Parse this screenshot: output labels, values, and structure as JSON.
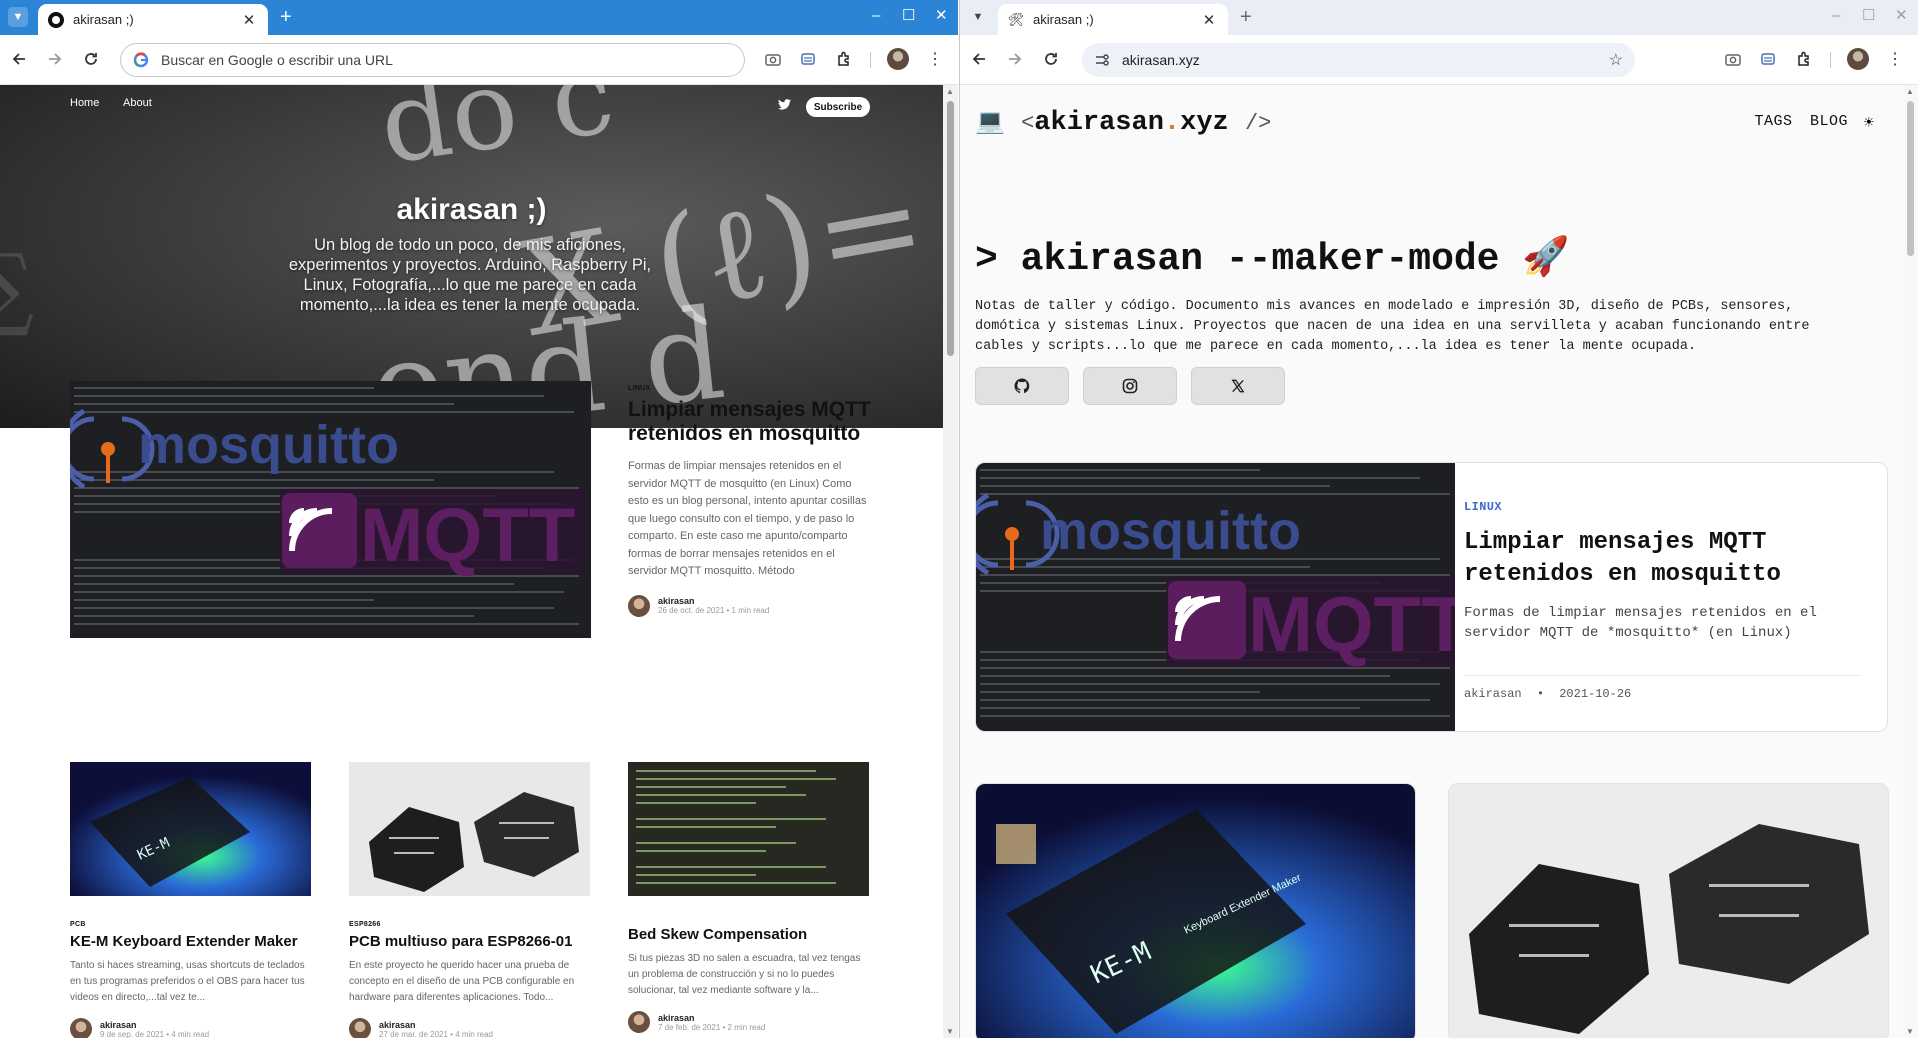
{
  "left": {
    "tab_title": "akirasan ;)",
    "omnibox_placeholder": "Buscar en Google o escribir una URL",
    "site": {
      "nav": [
        "Home",
        "About"
      ],
      "subscribe": "Subscribe",
      "title": "akirasan ;)",
      "description": "Un blog de todo un poco, de mis aficiones, experimentos y proyectos. Arduino, Raspberry Pi, Linux, Fotografía,...lo que me parece en cada momento,...la idea es tener la mente ocupada.",
      "featured": {
        "tag": "LINUX",
        "title": "Limpiar mensajes MQTT retenidos en mosquitto",
        "excerpt": "Formas de limpiar mensajes retenidos en el servidor MQTT de mosquitto (en Linux) Como esto es un blog personal, intento apuntar cosillas que luego consulto con el tiempo, y de paso lo comparto. En este caso me apunto/comparto formas de borrar mensajes retenidos en el servidor MQTT mosquitto. Método",
        "author": "akirasan",
        "meta": "26 de oct. de 2021 • 1 min read"
      },
      "posts": [
        {
          "tag": "PCB",
          "title": "KE-M Keyboard Extender Maker",
          "excerpt": "Tanto si haces streaming, usas shortcuts de teclados en tus programas preferidos o el OBS para hacer tus videos en directo,...tal vez te...",
          "author": "akirasan",
          "meta": "9 de sep. de 2021 • 4 min read"
        },
        {
          "tag": "ESP8266",
          "title": "PCB multiuso para ESP8266-01",
          "excerpt": "En este proyecto he querido hacer una prueba de concepto en el diseño de una PCB configurable en hardware para diferentes aplicaciones. Todo...",
          "author": "akirasan",
          "meta": "27 de mar. de 2021 • 4 min read"
        },
        {
          "tag": "",
          "title": "Bed Skew Compensation",
          "excerpt": "Si tus piezas 3D no salen a escuadra, tal vez tengas un problema de construcción y si no lo puedes solucionar, tal vez mediante software y la...",
          "author": "akirasan",
          "meta": "7 de feb. de 2021 • 2 min read"
        }
      ]
    }
  },
  "right": {
    "tab_title": "akirasan ;)",
    "url": "akirasan.xyz",
    "site": {
      "logo_open": "<",
      "logo_name": "akirasan",
      "logo_dot": ".",
      "logo_tld": "xyz",
      "logo_close": "/>",
      "nav_tags": "TAGS",
      "nav_blog": "BLOG",
      "headline": "> akirasan --maker-mode 🚀",
      "description": "Notas de taller y código. Documento mis avances en modelado e impresión 3D, diseño de PCBs, sensores, domótica y sistemas Linux. Proyectos que nacen de una idea en una servilleta y acaban funcionando entre cables y scripts...lo que me parece en cada momento,...la idea es tener la mente ocupada.",
      "featured": {
        "tag": "LINUX",
        "title": "Limpiar mensajes MQTT retenidos en mosquitto",
        "excerpt": "Formas de limpiar mensajes retenidos en el servidor MQTT de *mosquitto* (en Linux)",
        "author": "akirasan",
        "sep": "•",
        "date": "2021-10-26"
      }
    }
  },
  "image_text": {
    "mosquitto": "mosquitto",
    "mqtt": "MQTT",
    "kem": "KE-M",
    "kem_sub": "Keyboard Extender Maker"
  },
  "colors": {
    "chrome_left": "#2b84d6",
    "chrome_right": "#e9eef6",
    "accent_dot": "#e07b16",
    "tag_blue": "#3f6bd1"
  }
}
